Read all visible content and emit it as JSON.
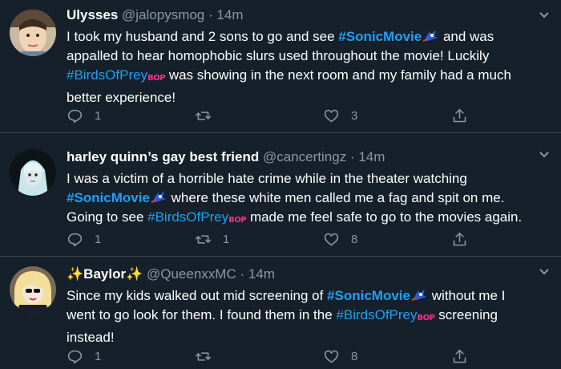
{
  "tweets": [
    {
      "name": "Ulysses",
      "handle": "@jalopysmog",
      "time": "14m",
      "text_1": "I took my husband and 2 sons to go and see ",
      "hashtag_1": "#SonicMovie",
      "text_2": " and was appalled to hear homophobic slurs used throughout the movie! Luckily ",
      "hashtag_2": "#BirdsOfPrey",
      "text_3": " was showing in the next room and my family had a much better experience!",
      "replies": "1",
      "retweets": "",
      "likes": "3"
    },
    {
      "name": "harley quinn’s gay best friend",
      "handle": "@cancertingz",
      "time": "14m",
      "text_1": "I was a victim of a horrible hate crime while in the theater watching ",
      "hashtag_1": "#SonicMovie",
      "text_2": " where these white men called me a fag and spit on me. Going to see ",
      "hashtag_2": "#BirdsOfPrey",
      "text_3": " made me feel safe to go to the movies again.",
      "replies": "1",
      "retweets": "1",
      "likes": "8"
    },
    {
      "name": "✨Baylor✨",
      "handle": "@QueenxxMC",
      "time": "14m",
      "text_1": "Since my kids walked out mid screening of ",
      "hashtag_1": "#SonicMovie",
      "text_2": " without me I went to go look for them. I found them in the ",
      "hashtag_2": "#BirdsOfPrey",
      "text_3": " screening instead!",
      "replies": "1",
      "retweets": "",
      "likes": "8"
    }
  ],
  "emoji_bop_label": "BOP",
  "sep": "·",
  "icons": [
    "reply-icon",
    "retweet-icon",
    "like-icon",
    "share-icon",
    "caret-down-icon",
    "sonic-emoji-icon"
  ],
  "colors": {
    "background": "#15202b",
    "link": "#1da1f2",
    "muted": "#8899a6",
    "divider": "#38444d",
    "bop": "#ff2d87"
  }
}
